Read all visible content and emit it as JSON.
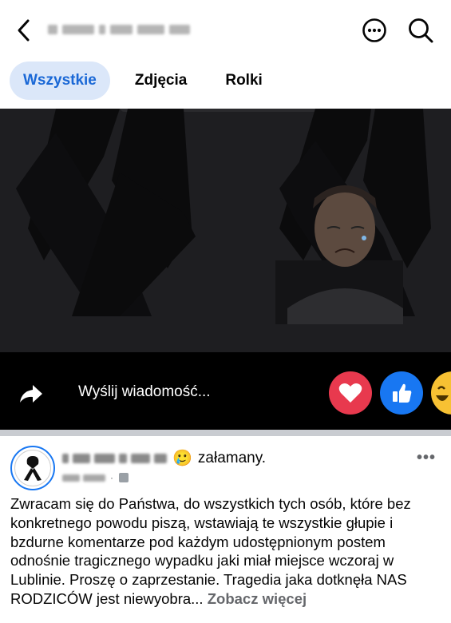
{
  "header": {
    "back_icon": "chevron-left-icon",
    "more_icon": "more-horizontal-circle-icon",
    "search_icon": "search-icon"
  },
  "tabs": [
    {
      "label": "Wszystkie",
      "active": true
    },
    {
      "label": "Zdjęcia",
      "active": false
    },
    {
      "label": "Rolki",
      "active": false
    }
  ],
  "reel": {
    "share_icon": "share-arrow-icon",
    "message_placeholder": "Wyślij wiadomość...",
    "reactions": [
      "love",
      "like",
      "haha"
    ]
  },
  "post": {
    "feeling_emoji": "🥲",
    "feeling": "załamany.",
    "options": "•••",
    "text": "Zwracam się do Państwa, do wszystkich tych osób, które bez konkretnego powodu piszą, wstawiają te wszystkie głupie i bzdurne komentarze pod każdym udostępnionym postem odnośnie tragicznego wypadku jaki miał miejsce wczoraj w Lublinie. Proszę o  zaprzestanie. Tragedia jaka dotknęła NAS RODZICÓW jest niewyobra...",
    "see_more": "Zobacz więcej"
  },
  "colors": {
    "accent": "#1877f2",
    "tab_active_bg": "#dbe7f9",
    "tab_active_text": "#1a68d6",
    "love": "#e8394e",
    "haha": "#f7c133"
  }
}
